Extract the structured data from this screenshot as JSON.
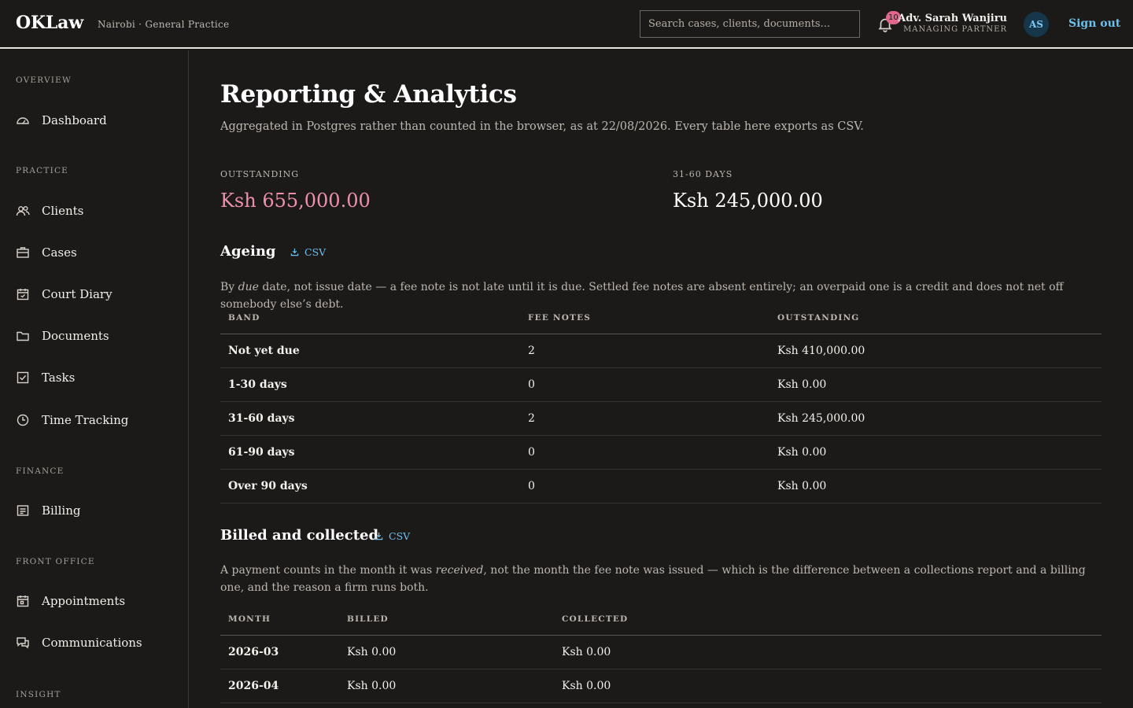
{
  "header": {
    "brand": "OKLaw",
    "brand_sub": "Nairobi · General Practice",
    "search_placeholder": "Search cases, clients, documents...",
    "notification_count": "10",
    "user_name": "Adv. Sarah Wanjiru",
    "user_role": "MANAGING PARTNER",
    "avatar_initials": "AS",
    "sign_out": "Sign out"
  },
  "sidebar": {
    "sections": {
      "overview": "OVERVIEW",
      "practice": "PRACTICE",
      "finance": "FINANCE",
      "front_office": "FRONT OFFICE",
      "insight": "INSIGHT"
    },
    "items": {
      "dashboard": "Dashboard",
      "clients": "Clients",
      "cases": "Cases",
      "court_diary": "Court Diary",
      "documents": "Documents",
      "tasks": "Tasks",
      "time_tracking": "Time Tracking",
      "billing": "Billing",
      "appointments": "Appointments",
      "communications": "Communications"
    }
  },
  "main": {
    "title": "Reporting & Analytics",
    "subtitle": "Aggregated in Postgres rather than counted in the browser, as at 22/08/2026. Every table here exports as CSV.",
    "kpis": {
      "outstanding_label": "OUTSTANDING",
      "outstanding_value": "Ksh 655,000.00",
      "days_31_60_label": "31-60 DAYS",
      "days_31_60_value": "Ksh 245,000.00"
    },
    "ageing": {
      "title": "Ageing",
      "csv": "CSV",
      "desc_before": "By ",
      "desc_em": "due",
      "desc_after": " date, not issue date — a fee note is not late until it is due. Settled fee notes are absent entirely; an overpaid one is a credit and does not net off somebody else’s debt.",
      "columns": [
        "BAND",
        "FEE NOTES",
        "OUTSTANDING"
      ],
      "rows": [
        [
          "Not yet due",
          "2",
          "Ksh 410,000.00"
        ],
        [
          "1-30 days",
          "0",
          "Ksh 0.00"
        ],
        [
          "31-60 days",
          "2",
          "Ksh 245,000.00"
        ],
        [
          "61-90 days",
          "0",
          "Ksh 0.00"
        ],
        [
          "Over 90 days",
          "0",
          "Ksh 0.00"
        ]
      ]
    },
    "billed": {
      "title": "Billed and collected",
      "csv": "CSV",
      "desc_before": "A payment counts in the month it was ",
      "desc_em": "received",
      "desc_after": ", not the month the fee note was issued — which is the difference between a collections report and a billing one, and the reason a firm runs both.",
      "columns": [
        "MONTH",
        "BILLED",
        "COLLECTED"
      ],
      "rows": [
        [
          "2026-03",
          "Ksh 0.00",
          "Ksh 0.00"
        ],
        [
          "2026-04",
          "Ksh 0.00",
          "Ksh 0.00"
        ]
      ]
    }
  },
  "colors": {
    "accent_link": "#6cc0ee",
    "outstanding_pink": "#ef8fae",
    "badge": "#e0668c"
  }
}
